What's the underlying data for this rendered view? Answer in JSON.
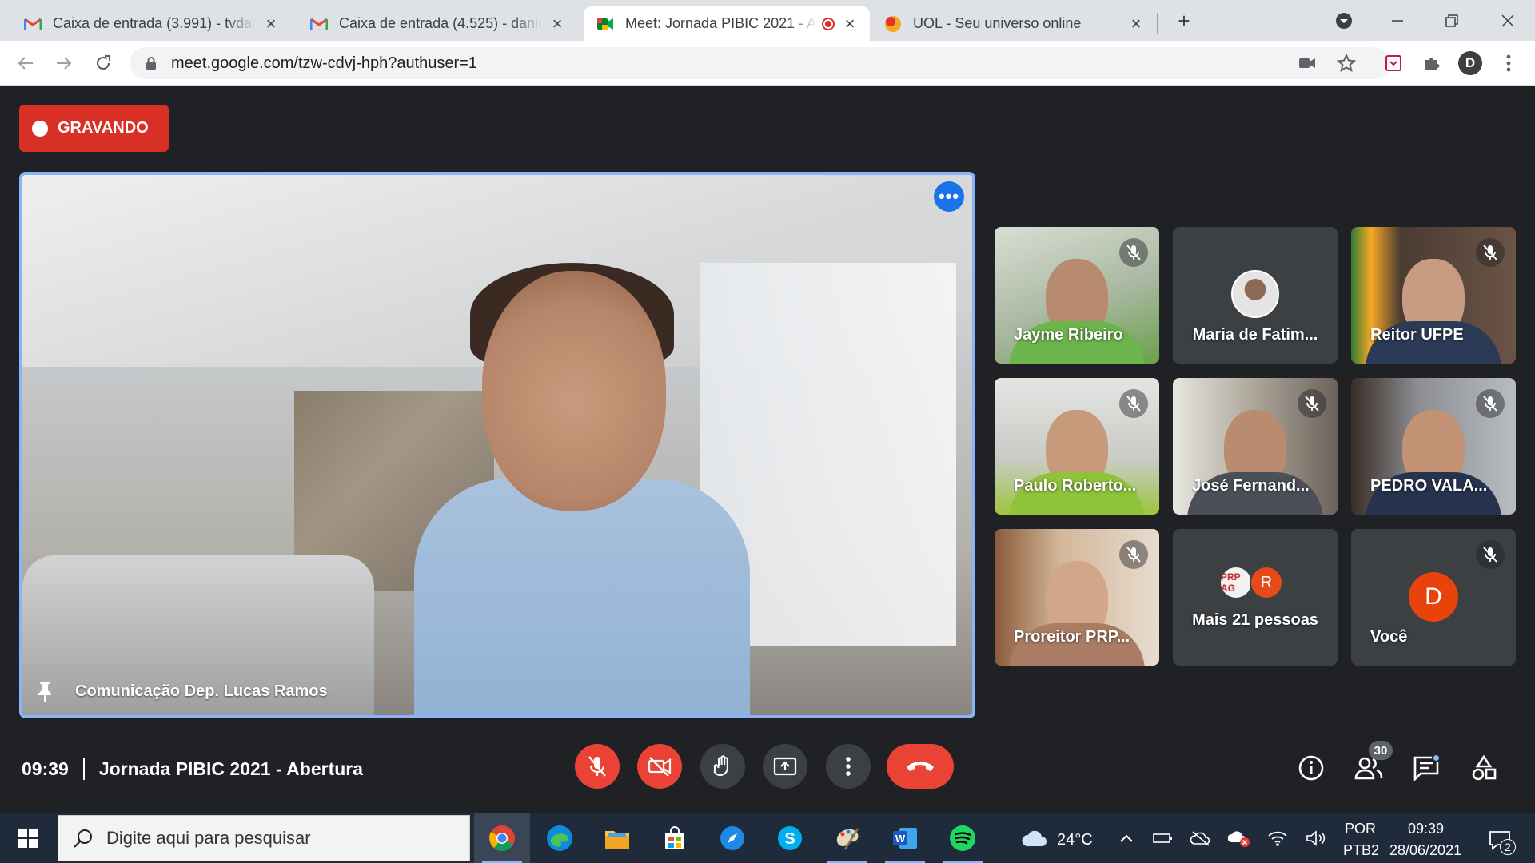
{
  "browser": {
    "tabs": [
      {
        "title": "Caixa de entrada (3.991) - tvdanie",
        "favicon": "gmail-icon"
      },
      {
        "title": "Caixa de entrada (4.525) - daniel.",
        "favicon": "gmail-icon"
      },
      {
        "title": "Meet: Jornada PIBIC 2021 - A",
        "favicon": "meet-icon",
        "active": true
      },
      {
        "title": "UOL - Seu universo online",
        "favicon": "uol-icon"
      }
    ],
    "url": "meet.google.com/tzw-cdvj-hph?authuser=1",
    "profile_initial": "D"
  },
  "meet": {
    "recording_label": "GRAVANDO",
    "main_speaker": "Comunicação Dep. Lucas Ramos",
    "participants": [
      {
        "name": "Jayme Ribeiro",
        "muted": true,
        "kind": "video"
      },
      {
        "name": "Maria de Fatim...",
        "muted": false,
        "kind": "avatar"
      },
      {
        "name": "Reitor UFPE",
        "muted": true,
        "kind": "video"
      },
      {
        "name": "Paulo Roberto...",
        "muted": true,
        "kind": "video"
      },
      {
        "name": "José Fernand...",
        "muted": true,
        "kind": "video"
      },
      {
        "name": "PEDRO VALA...",
        "muted": true,
        "kind": "video"
      },
      {
        "name": "Proreitor PRP...",
        "muted": true,
        "kind": "video"
      },
      {
        "name": "Mais 21 pessoas",
        "muted": false,
        "kind": "more",
        "avatar_texts": [
          "PRP AG",
          "R"
        ]
      },
      {
        "name": "Você",
        "muted": true,
        "kind": "letter",
        "initial": "D"
      }
    ],
    "time": "09:39",
    "meeting_title": "Jornada PIBIC 2021 - Abertura",
    "participant_count": "30",
    "colors": {
      "accent": "#8ab4f8",
      "danger": "#ea4335",
      "recording": "#d93025",
      "background": "#202124",
      "tile": "#3c4043"
    }
  },
  "taskbar": {
    "search_placeholder": "Digite aqui para pesquisar",
    "weather": "24°C",
    "language": "POR",
    "keyboard": "PTB2",
    "clock_time": "09:39",
    "clock_date": "28/06/2021",
    "notification_count": "2"
  }
}
